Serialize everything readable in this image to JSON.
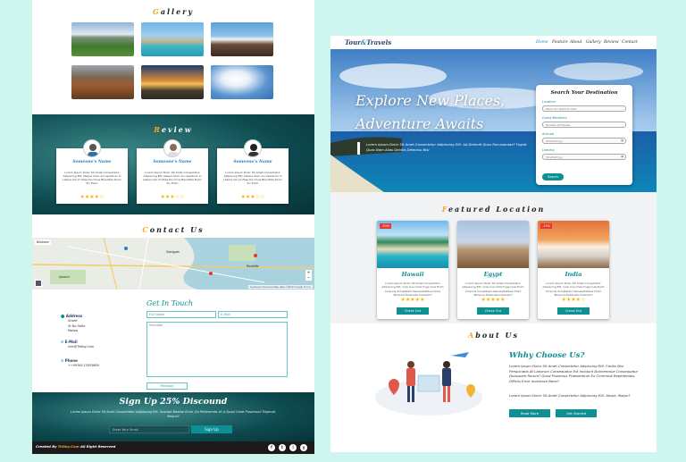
{
  "left": {
    "gallery_title_first": "G",
    "gallery_title_rest": "allery",
    "review_title_first": "R",
    "review_title_rest": "eview",
    "reviews": [
      {
        "name": "Someone's Name",
        "text": "Lorem Ipsum Dolor Sit Amet Consectetur Adipiscing Elit. Neque Illum Accusantium In Labore Vel Id Vitae Ducimus Blanditiis Dolor Sic Enim",
        "stars": "★★★★☆"
      },
      {
        "name": "Someone's Name",
        "text": "Lorem Ipsum Dolor Sit Amet Consectetur Adipiscing Elit. Neque Illum Accusantium In Labore Vel Id Vitae Ducimus Blanditiis Dolor Sic Enim",
        "stars": "★★★☆☆"
      },
      {
        "name": "Someone's Name",
        "text": "Lorem Ipsum Dolor Sit Amet Consectetur Adipiscing Elit. Neque Illum Accusantium In Labore Vel Id Vitae Ducimus Blanditiis Dolor Sic Enim",
        "stars": "★★★☆☆"
      }
    ],
    "contact_title_first": "C",
    "contact_title_rest": "ontact Us",
    "map_labels": [
      "Brisbane",
      "Sandgate",
      "Redcliffe",
      "Ipswich"
    ],
    "map_attrib": "Keyboard shortcuts  Map data ©2023 Google  Terms",
    "get_in_touch": "Get In Touch",
    "address_label": "Address",
    "address_value": "Street\nSt No Satle\nMalaw",
    "email_label": "E-Mail",
    "email_value": "info@Tribby.Com",
    "phone_label": "Phone",
    "phone_value": "++9956117653669",
    "form_name": "Full Name",
    "form_email": "E-Mail",
    "form_message": "Message",
    "form_submit": "Message",
    "signup_title": "Sign Up 25% Discound",
    "signup_text": "Lorem Ipsum Dolor Sit Amet Consectetur Adipiscing Elit. Suscipit Beatae Enim, Ea Perferendis Ut A Quasi Unde Possimus? Eligendi, Neque?",
    "signup_placeholder": "Enter Your Email",
    "signup_button": "Sign Up",
    "footer_prefix": "Created By ",
    "footer_brand": "Tribby.Com",
    "footer_suffix": " All Right Reserved",
    "social": [
      "f",
      "t",
      "i",
      "y"
    ]
  },
  "right": {
    "logo_a": "Tour",
    "logo_b": "&",
    "logo_c": "Travels",
    "nav": [
      "Home",
      "Feature",
      "About",
      "Gallery",
      "Review",
      "Contact"
    ],
    "hero_line1": "Explore New Places,",
    "hero_line2": "Adventure Awaits",
    "hero_text": "Lorem Ipsum Dolor Sit Amet Consectetur Adipiscing Elit. Ad Deleniti Quos Recusandae? Fugiat Quas Nam Alias Debitis Delectus Nisi",
    "search_title": "Search Your Destination",
    "search_fields": [
      {
        "label": "Location",
        "value": "Place You Want To Visit"
      },
      {
        "label": "Guest Members",
        "value": "Number Of People"
      },
      {
        "label": "Arrivals",
        "value": "Mm/Dd/Yyyy"
      },
      {
        "label": "Leaving",
        "value": "Mm/Dd/Yyyy"
      }
    ],
    "search_button": "Search",
    "featured_first": "F",
    "featured_rest": "eatured Location",
    "locations": [
      {
        "name": "Hawaii",
        "badge": "-30%",
        "text": "Lorem Ipsum Dolor Sit Amet Consectetur Adipiscing Elit. Quis Cus Unde Fuga Quis Enim Corporis Voluptatem Necessitatibus Omni Tempore Explicabo Dolorem?",
        "stars": "★★★★★",
        "button": "Check Out"
      },
      {
        "name": "Egypt",
        "badge": "",
        "text": "Lorem Ipsum Dolor Sit Amet Consectetur Adipiscing Elit. Quis Cus Unde Fuga Quis Enim Corporis Voluptatem Necessitatibus Omni Tempore Explicabo Dolorem?",
        "stars": "★★★★★",
        "button": "Check Out"
      },
      {
        "name": "India",
        "badge": "-15%",
        "text": "Lorem Ipsum Dolor Sit Amet Consectetur Adipiscing Elit. Quis Cus Unde Fuga Quis Enim Corporis Voluptatem Necessitatibus Omni Tempore Explicabo Dolorem?",
        "stars": "★★★★☆",
        "button": "Check Out"
      }
    ],
    "about_first": "A",
    "about_rest": "bout Us",
    "about_heading": "Whhy Choose Us?",
    "about_p1": "Lorem Ipsum Dolor Sit Amet Consectetur Adipiscing Elit. Facilis Nisi Perspiciatis At Laborum Consequatur Est Incidunt Doloremque Consequatur Quisquam Rerum? Quod Possimus Praesentium Ex Commodi Repellendus. Officiis Error Inventore Bene?",
    "about_p2": "Lorem Ipsum Dolor Sit Amet Consectetur Adipiscing Elit. Atque, Magni?",
    "read_more": "Read More",
    "get_started": "Get Started"
  }
}
